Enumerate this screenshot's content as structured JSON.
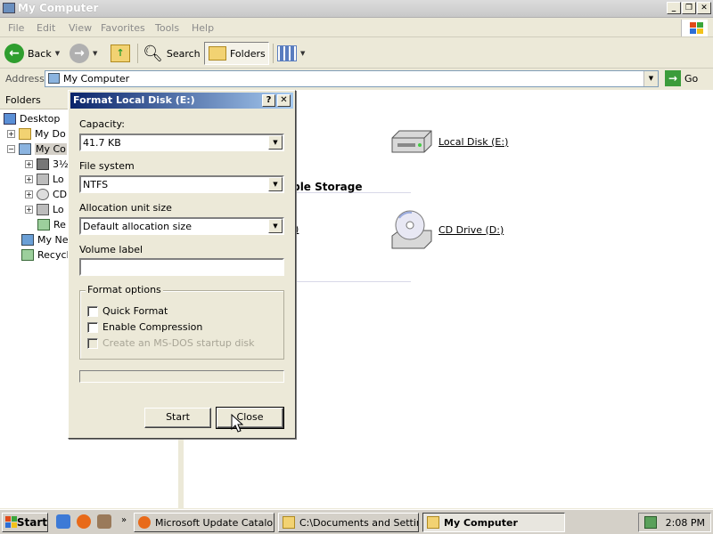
{
  "window": {
    "title": "My Computer"
  },
  "menu": [
    "File",
    "Edit",
    "View",
    "Favorites",
    "Tools",
    "Help"
  ],
  "toolbar": {
    "back": "Back",
    "search": "Search",
    "folders": "Folders"
  },
  "address": {
    "label": "Address",
    "value": "My Computer",
    "go": "Go"
  },
  "folders_pane": {
    "title": "Folders",
    "items": [
      "Desktop",
      "My Do",
      "My Co",
      "3½",
      "Lo",
      "CD",
      "Lo",
      "Re",
      "My Ne",
      "Recycl"
    ]
  },
  "content": {
    "items": [
      ":)",
      "Local Disk (E:)",
      "A:)",
      "CD Drive (D:)"
    ],
    "section_heading": "able Storage"
  },
  "dialog": {
    "title": "Format Local Disk (E:)",
    "help_btn": "?",
    "close_btn": "✕",
    "capacity_label": "Capacity:",
    "capacity_value": "41.7 KB",
    "filesystem_label": "File system",
    "filesystem_value": "NTFS",
    "allocation_label": "Allocation unit size",
    "allocation_value": "Default allocation size",
    "volume_label": "Volume label",
    "volume_value": "",
    "options_title": "Format options",
    "opt_quick": "Quick Format",
    "opt_compress": "Enable Compression",
    "opt_msdos": "Create an MS-DOS startup disk",
    "start": "Start",
    "close": "Close"
  },
  "taskbar": {
    "start": "Start",
    "tasks": [
      "Microsoft Update Catalo...",
      "C:\\Documents and Settin...",
      "My Computer"
    ],
    "clock": "2:08 PM"
  }
}
